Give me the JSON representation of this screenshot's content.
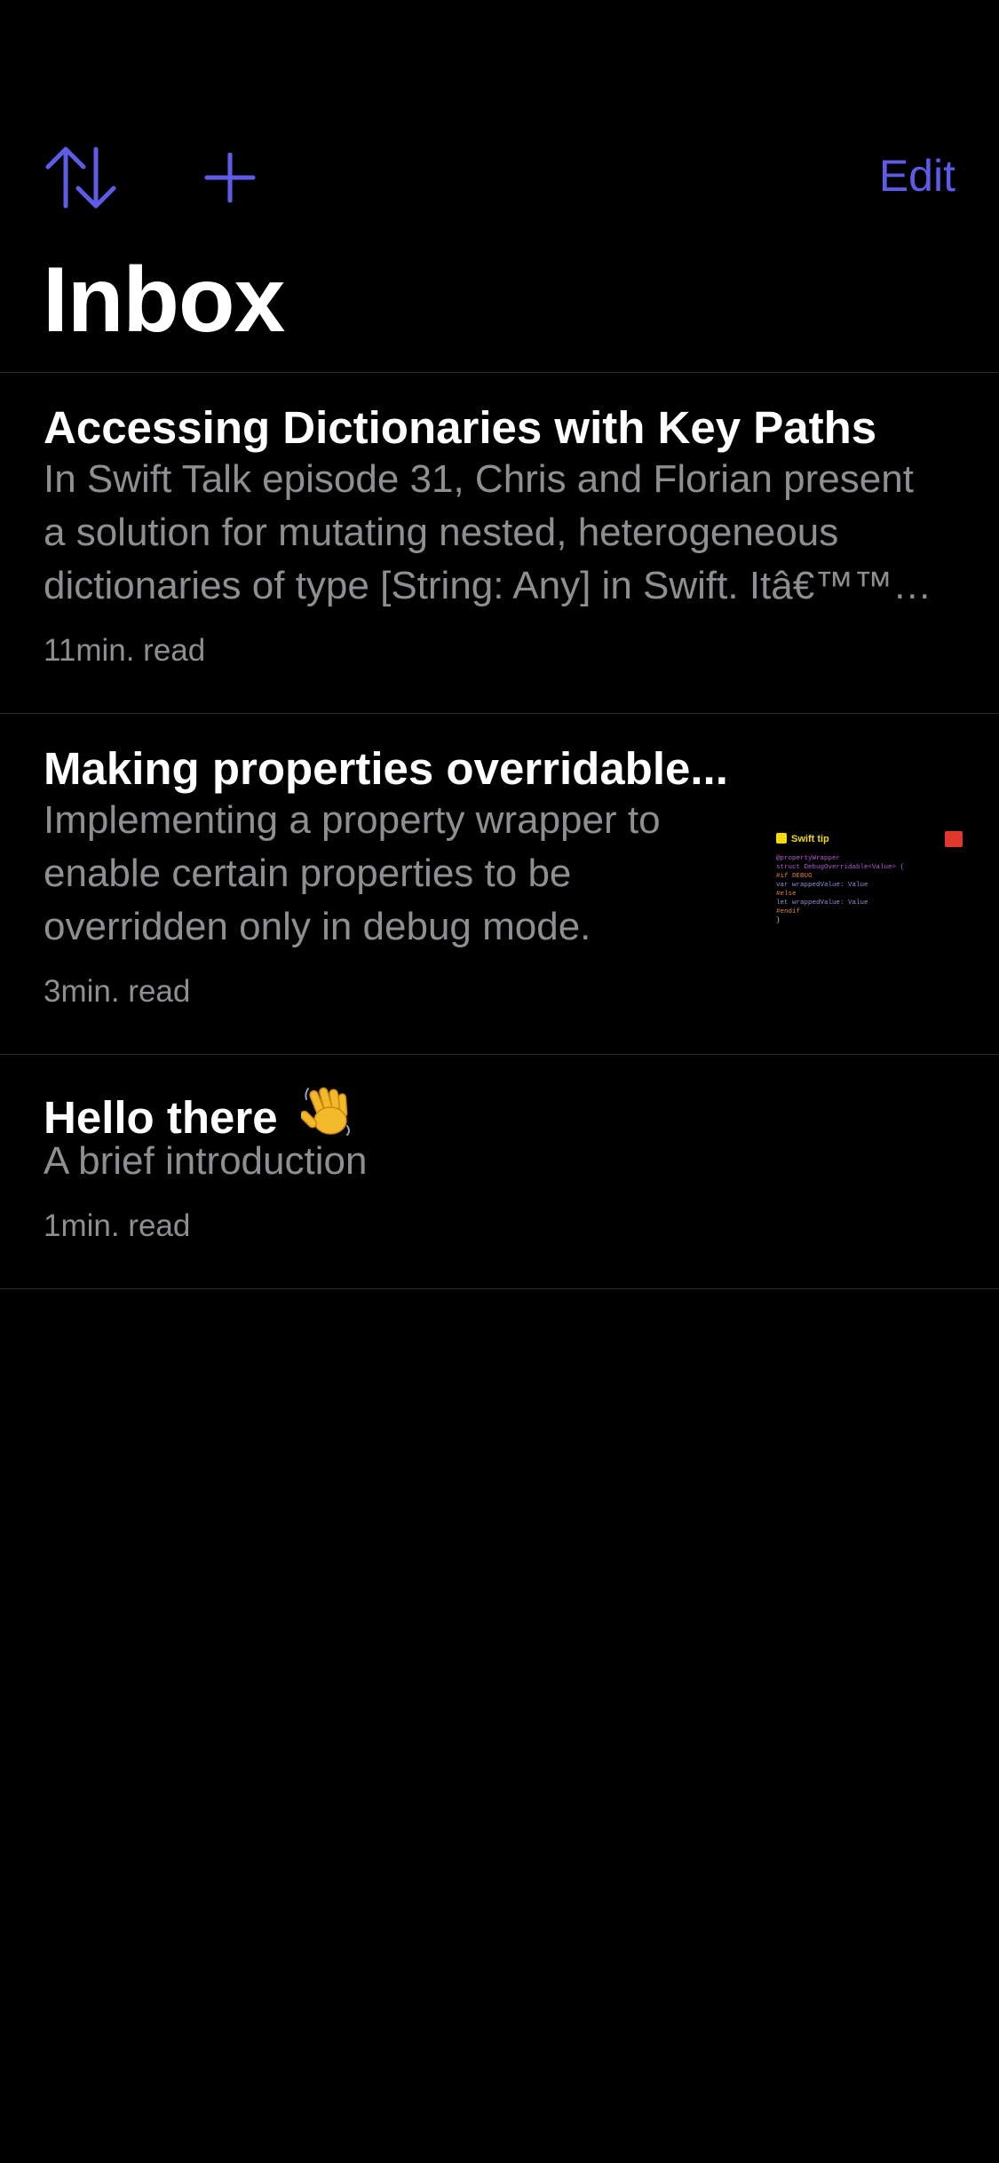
{
  "nav": {
    "sort_icon": "sort-arrows-icon",
    "add_icon": "plus-icon",
    "edit_label": "Edit",
    "accent_color": "#5e5ce6"
  },
  "title": "Inbox",
  "articles": [
    {
      "title": "Accessing Dictionaries with Key Paths",
      "summary_lines": [
        "In Swift Talk episode 31, Chris and Florian present",
        "a solution for mutating nested, heterogeneous",
        "dictionaries of type [String: Any] in Swift. Itâ€™™…"
      ],
      "read_time": "11min. read"
    },
    {
      "title": "Making properties overridable...",
      "summary_lines": [
        "Implementing a property wrapper to",
        "enable certain properties to be",
        "overridden only in debug mode."
      ],
      "read_time": "3min. read",
      "thumbnail": {
        "header": "Swift tip",
        "code_lines": [
          "@propertyWrapper",
          "struct DebugOverridable<Value> {",
          "  #if DEBUG",
          "  var wrappedValue: Value",
          "  #else",
          "  let wrappedValue: Value",
          "  #endif",
          "}"
        ]
      }
    },
    {
      "title": "Hello there",
      "title_icon": "waving-hand-icon",
      "summary_lines": [
        "A brief introduction"
      ],
      "read_time": "1min. read"
    }
  ]
}
